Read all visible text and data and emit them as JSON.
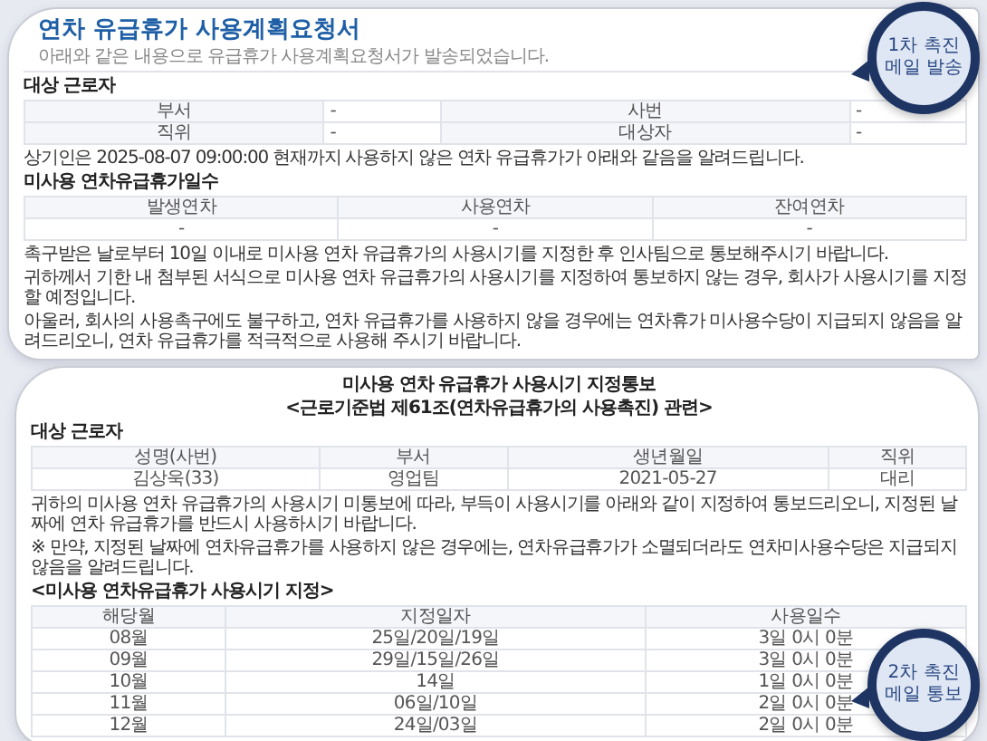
{
  "cards": [
    {
      "callout": {
        "lines": [
          "1차 촉진",
          "메일 발송"
        ]
      },
      "blocks": [
        {
          "kind": "title",
          "text": "연차 유급휴가 사용계획요청서"
        },
        {
          "kind": "subtitle",
          "text": "아래와 같은 내용으로 유급휴가 사용계획요청서가 발송되었습니다."
        },
        {
          "kind": "heading",
          "text": "대상 근로자"
        },
        {
          "kind": "pairs",
          "rows": [
            [
              {
                "label": "부서",
                "value": "-"
              },
              {
                "label": "사번",
                "value": "-"
              }
            ],
            [
              {
                "label": "직위",
                "value": "-"
              },
              {
                "label": "대상자",
                "value": "-"
              }
            ]
          ]
        },
        {
          "kind": "paragraph",
          "text": "상기인은 2025-08-07 09:00:00 현재까지 사용하지 않은 연차 유급휴가가 아래와 같음을 알려드립니다."
        },
        {
          "kind": "heading",
          "text": "미사용 연차유급휴가일수"
        },
        {
          "kind": "grid",
          "header": [
            "발생연차",
            "사용연차",
            "잔여연차"
          ],
          "rows": [
            [
              "-",
              "-",
              "-"
            ]
          ]
        },
        {
          "kind": "paragraph",
          "text": "촉구받은 날로부터 10일 이내로 미사용 연차 유급휴가의 사용시기를 지정한 후 인사팀으로 통보해주시기 바랍니다."
        },
        {
          "kind": "paragraph",
          "text": "귀하께서 기한 내 첨부된 서식으로 미사용 연차 유급휴가의 사용시기를 지정하여 통보하지 않는 경우, 회사가 사용시기를 지정할 예정입니다."
        },
        {
          "kind": "paragraph",
          "text": "아울러, 회사의 사용촉구에도 불구하고, 연차 유급휴가를 사용하지 않을 경우에는 연차휴가 미사용수당이 지급되지 않음을 알려드리오니, 연차 유급휴가를 적극적으로 사용해 주시기 바랍니다."
        }
      ]
    },
    {
      "callout": {
        "lines": [
          "2차 촉진",
          "메일 통보"
        ]
      },
      "blocks": [
        {
          "kind": "center",
          "text": "미사용 연차 유급휴가 사용시기 지정통보"
        },
        {
          "kind": "center",
          "text": "<근로기준법 제61조(연차유급휴가의 사용촉진) 관련>"
        },
        {
          "kind": "heading",
          "text": "대상 근로자"
        },
        {
          "kind": "grid",
          "header": [
            "성명(사번)",
            "부서",
            "생년월일",
            "직위"
          ],
          "rows": [
            [
              "김상욱(33)",
              "영업팀",
              "2021-05-27",
              "대리"
            ]
          ]
        },
        {
          "kind": "paragraph",
          "text": "귀하의 미사용 연차 유급휴가의 사용시기 미통보에 따라, 부득이 사용시기를 아래와 같이 지정하여 통보드리오니, 지정된 날짜에 연차 유급휴가를 반드시 사용하시기 바랍니다."
        },
        {
          "kind": "paragraph",
          "text": "※ 만약, 지정된 날짜에 연차유급휴가를 사용하지 않은 경우에는, 연차유급휴가가 소멸되더라도 연차미사용수당은 지급되지 않음을 알려드립니다."
        },
        {
          "kind": "heading",
          "text": "<미사용 연차유급휴가 사용시기 지정>"
        },
        {
          "kind": "grid",
          "header": [
            "해당월",
            "지정일자",
            "사용일수"
          ],
          "rows": [
            [
              "08월",
              "25일/20일/19일",
              "3일 0시 0분"
            ],
            [
              "09월",
              "29일/15일/26일",
              "3일 0시 0분"
            ],
            [
              "10월",
              "14일",
              "1일 0시 0분"
            ],
            [
              "11월",
              "06일/10일",
              "2일 0시 0분"
            ],
            [
              "12월",
              "24일/03일",
              "2일 0시 0분"
            ]
          ]
        }
      ]
    }
  ]
}
